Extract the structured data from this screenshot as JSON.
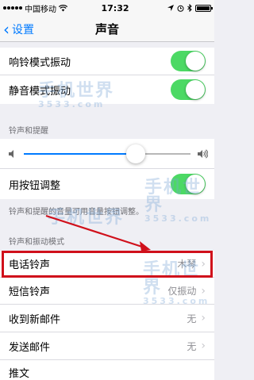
{
  "status_bar": {
    "carrier": "中国移动",
    "time": "17:32"
  },
  "nav": {
    "back_label": "设置",
    "title": "声音"
  },
  "vibrate_section": {
    "ring_vibrate_label": "响铃模式振动",
    "ring_vibrate_on": true,
    "silent_vibrate_label": "静音模式振动",
    "silent_vibrate_on": true
  },
  "ringer_section": {
    "header": "铃声和提醒",
    "volume_level": 0.67,
    "change_with_buttons_label": "用按钮调整",
    "change_with_buttons_on": true,
    "note": "铃声和提醒的音量可用音量按钮调整。"
  },
  "patterns_section": {
    "header": "铃声和振动模式",
    "rows": [
      {
        "label": "电话铃声",
        "value": "木琴"
      },
      {
        "label": "短信铃声",
        "value": "仅振动"
      },
      {
        "label": "收到新邮件",
        "value": "无"
      },
      {
        "label": "发送邮件",
        "value": "无"
      },
      {
        "label": "推文",
        "value": ""
      }
    ]
  },
  "watermark": {
    "main": "手机世界",
    "sub": "3533.com"
  },
  "colors": {
    "accent": "#007aff",
    "toggle_on": "#4cd964",
    "highlight": "#d0101b"
  }
}
